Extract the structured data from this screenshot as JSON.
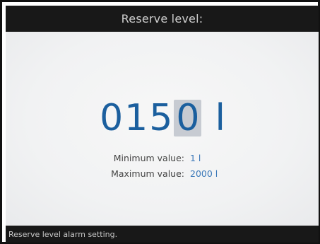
{
  "header": {
    "title": "Reserve level:"
  },
  "entry": {
    "digits": [
      "0",
      "1",
      "5",
      "0"
    ],
    "active_digit_index": 3,
    "unit": "l"
  },
  "limits": {
    "min_label": "Minimum value:",
    "min_value": "1 l",
    "max_label": "Maximum value:",
    "max_value": "2000 l"
  },
  "footer": {
    "status_text": "Reserve level alarm setting."
  },
  "colors": {
    "header_bg": "#181818",
    "value_blue": "#1b5f9e",
    "limit_value_blue": "#3a78b8",
    "active_digit_bg": "#c7cbd2"
  }
}
